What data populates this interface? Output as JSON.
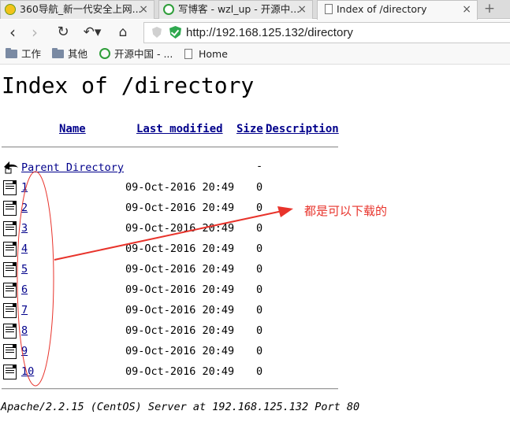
{
  "browser": {
    "tabs": [
      {
        "title": "360导航_新一代安全上网...",
        "close": "×",
        "favicon": "360-logo-icon"
      },
      {
        "title": "写博客 - wzl_up - 开源中...",
        "close": "×",
        "favicon": "cnblogs-icon"
      },
      {
        "title": "Index of /directory",
        "close": "×",
        "favicon": "page-icon",
        "active": true
      }
    ],
    "new_tab": "+",
    "url": "http://192.168.125.132/directory",
    "bookmarks": [
      "工作",
      "其他",
      "开源中国 - ...",
      "Home"
    ]
  },
  "page": {
    "title": "Index of /directory",
    "columns": {
      "name": "Name",
      "last_modified": "Last modified",
      "size": "Size",
      "description": "Description"
    },
    "parent": {
      "label": "Parent Directory",
      "size": "-"
    },
    "files": [
      {
        "name": "1",
        "modified": "09-Oct-2016 20:49",
        "size": "0"
      },
      {
        "name": "2",
        "modified": "09-Oct-2016 20:49",
        "size": "0"
      },
      {
        "name": "3",
        "modified": "09-Oct-2016 20:49",
        "size": "0"
      },
      {
        "name": "4",
        "modified": "09-Oct-2016 20:49",
        "size": "0"
      },
      {
        "name": "5",
        "modified": "09-Oct-2016 20:49",
        "size": "0"
      },
      {
        "name": "6",
        "modified": "09-Oct-2016 20:49",
        "size": "0"
      },
      {
        "name": "7",
        "modified": "09-Oct-2016 20:49",
        "size": "0"
      },
      {
        "name": "8",
        "modified": "09-Oct-2016 20:49",
        "size": "0"
      },
      {
        "name": "9",
        "modified": "09-Oct-2016 20:49",
        "size": "0"
      },
      {
        "name": "10",
        "modified": "09-Oct-2016 20:49",
        "size": "0"
      }
    ],
    "footer": "Apache/2.2.15 (CentOS) Server at 192.168.125.132 Port 80"
  },
  "annotation": {
    "text": "都是可以下载的",
    "color": "#e8332b"
  },
  "colors": {
    "link": "#00008b",
    "annotation": "#e8332b"
  }
}
